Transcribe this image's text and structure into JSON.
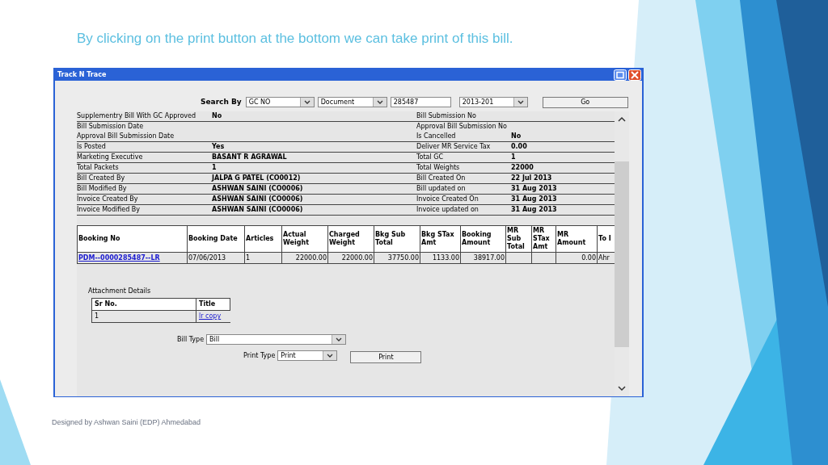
{
  "slide": {
    "heading": "By clicking on the print button at the bottom we can take print of this bill.",
    "footer": "Designed by Ashwan Saini (EDP) Ahmedabad"
  },
  "window": {
    "title": "Track N Trace"
  },
  "search": {
    "label": "Search By",
    "search_type": "GC NO",
    "document_type": "Document",
    "number": "285487",
    "year": "2013-201",
    "button": "Go"
  },
  "details": [
    {
      "label": "Supplementry Bill With GC Approved",
      "value": "No",
      "label_2": "Bill Submission No",
      "group_end": true
    },
    {
      "label": "Bill Submission Date",
      "label_2": "Approval Bill Submission No",
      "group_end": false
    },
    {
      "label": "Approval Bill Submission Date",
      "label_2": "Is Cancelled",
      "value_2": "No",
      "group_end": true
    },
    {
      "label": "Is Posted",
      "value": "Yes",
      "label_2": "Deliver MR Service Tax",
      "value_2": "0.00",
      "group_end": true
    },
    {
      "label": "Marketing Executive",
      "value": "BASANT R AGRAWAL",
      "label_2": "Total GC",
      "value_2": "1",
      "group_end": true
    },
    {
      "label": "Total Packets",
      "value": "1",
      "label_2": "Total Weights",
      "value_2": "22000",
      "group_end": true
    },
    {
      "label": "Bill Created By",
      "value": "JALPA G PATEL (CO0012)",
      "label_2": "Bill Created On",
      "value_2": "22 Jul 2013",
      "group_end": true
    },
    {
      "label": "Bill Modified By",
      "value": "ASHWAN SAINI (CO0006)",
      "label_2": "Bill updated on",
      "value_2": "31 Aug 2013",
      "group_end": true
    },
    {
      "label": "Invoice Created By",
      "value": "ASHWAN SAINI (CO0006)",
      "label_2": "Invoice Created On",
      "value_2": "31 Aug 2013",
      "group_end": true
    },
    {
      "label": "Invoice Modified By",
      "value": "ASHWAN SAINI (CO0006)",
      "label_2": "Invoice updated on",
      "value_2": "31 Aug 2013",
      "group_end": true
    }
  ],
  "bookings": {
    "columns": [
      "Booking No",
      "Booking Date",
      "Articles",
      "Actual Weight",
      "Charged Weight",
      "Bkg Sub Total",
      "Bkg STax Amt",
      "Booking Amount",
      "MR Sub Total",
      "MR STax Amt",
      "MR Amount",
      "To I"
    ],
    "rows": [
      [
        "PDM--0000285487--LR",
        "07/06/2013",
        "1",
        "22000.00",
        "22000.00",
        "37750.00",
        "1133.00",
        "38917.00",
        null,
        null,
        "0.00",
        "Ahr"
      ]
    ]
  },
  "attachments": {
    "title": "Attachment Details",
    "columns": [
      "Sr No.",
      "Title"
    ],
    "rows": [
      [
        "1",
        "lr copy"
      ]
    ]
  },
  "bill_type": {
    "label": "Bill Type",
    "value": "Bill"
  },
  "print_type": {
    "label": "Print Type",
    "value": "Print"
  },
  "print_button": "Print"
}
